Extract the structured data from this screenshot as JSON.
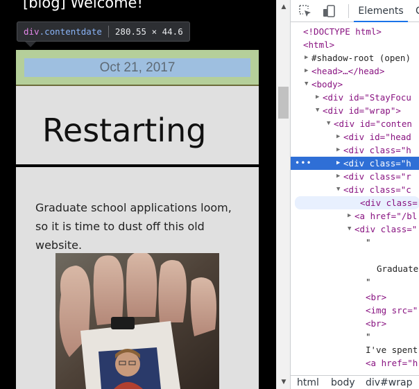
{
  "page": {
    "blog_header": "[blog] Welcome!",
    "tooltip": {
      "tag": "div",
      "class": ".contentdate",
      "size": "280.55 × 44.6"
    },
    "post": {
      "date": "Oct 21, 2017",
      "title": "Restarting",
      "body_lines": [
        "Graduate school applications loom,",
        "so it is time to dust off this old",
        "website."
      ]
    }
  },
  "devtools": {
    "tabs": {
      "active": "Elements",
      "next": "C"
    },
    "tree": [
      {
        "text": "<!DOCTYPE html>"
      },
      {
        "text": "<html>"
      },
      {
        "text": "#shadow-root (open)"
      },
      {
        "text": "<head>…</head>"
      },
      {
        "text": "<body>"
      },
      {
        "text": "<div id=\"StayFocu"
      },
      {
        "text": "<div id=\"wrap\">"
      },
      {
        "text": "<div id=\"conten"
      },
      {
        "text": "<div id=\"head"
      },
      {
        "text": "<div class=\"h"
      },
      {
        "text": "<div class=\"h"
      },
      {
        "text": "<div class=\"r"
      },
      {
        "text": "<div class=\"c"
      },
      {
        "text": "<div class="
      },
      {
        "text": "<a href=\"/bl"
      },
      {
        "text": "<div class=\""
      },
      {
        "text": "\""
      },
      {
        "text": "Graduate"
      },
      {
        "text": "\""
      },
      {
        "text": "<br>"
      },
      {
        "text": "<img src=\""
      },
      {
        "text": "<br>"
      },
      {
        "text": "\""
      },
      {
        "text": "I've spent"
      },
      {
        "text": "<a href=\"h"
      }
    ],
    "breadcrumb": [
      "html",
      "body",
      "div#wrap"
    ]
  },
  "colors": {
    "selected_row": "#2f6fd6",
    "date_highlight": "#b5cf9a",
    "date_box": "#9ebfe0"
  }
}
